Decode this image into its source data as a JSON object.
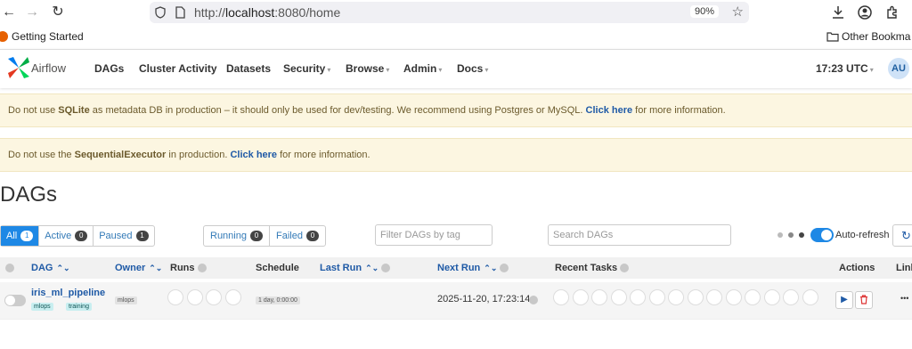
{
  "browser": {
    "url_prefix": "http://",
    "url_host": "localhost",
    "url_rest": ":8080/home",
    "zoom": "90%",
    "bookmark_getting_started": "Getting Started",
    "bookmark_other": "Other Bookma"
  },
  "nav": {
    "brand": "Airflow",
    "items": [
      "DAGs",
      "Cluster Activity",
      "Datasets",
      "Security",
      "Browse",
      "Admin",
      "Docs"
    ],
    "time": "17:23 UTC",
    "avatar": "AU"
  },
  "alerts": {
    "sqlite_pre": "Do not use ",
    "sqlite_bold": "SQLite",
    "sqlite_mid": " as metadata DB in production – it should only be used for dev/testing. We recommend using Postgres or MySQL. ",
    "sqlite_link": "Click here",
    "sqlite_post": " for more information.",
    "seq_pre": "Do not use the ",
    "seq_bold": "SequentialExecutor",
    "seq_mid": " in production. ",
    "seq_link": "Click here",
    "seq_post": " for more information."
  },
  "page_title": "DAGs",
  "filters": {
    "all_label": "All",
    "all_count": "1",
    "active_label": "Active",
    "active_count": "0",
    "paused_label": "Paused",
    "paused_count": "1",
    "running_label": "Running",
    "running_count": "0",
    "failed_label": "Failed",
    "failed_count": "0",
    "tag_placeholder": "Filter DAGs by tag",
    "search_placeholder": "Search DAGs",
    "autorefresh_label": "Auto-refresh"
  },
  "table": {
    "headers": {
      "dag": "DAG",
      "owner": "Owner",
      "runs": "Runs",
      "schedule": "Schedule",
      "last_run": "Last Run",
      "next_run": "Next Run",
      "recent_tasks": "Recent Tasks",
      "actions": "Actions",
      "links": "Link"
    },
    "row": {
      "dag_id": "iris_ml_pipeline",
      "tags": [
        "mlops",
        "training"
      ],
      "owner": "mlops",
      "schedule": "1 day, 0:00:00",
      "next_run": "2025-11-20, 17:23:14",
      "links_more": "•••"
    }
  },
  "colors": {
    "accent": "#1e88e5",
    "alert_bg": "#fcf6e1",
    "link": "#1f5aa6"
  }
}
